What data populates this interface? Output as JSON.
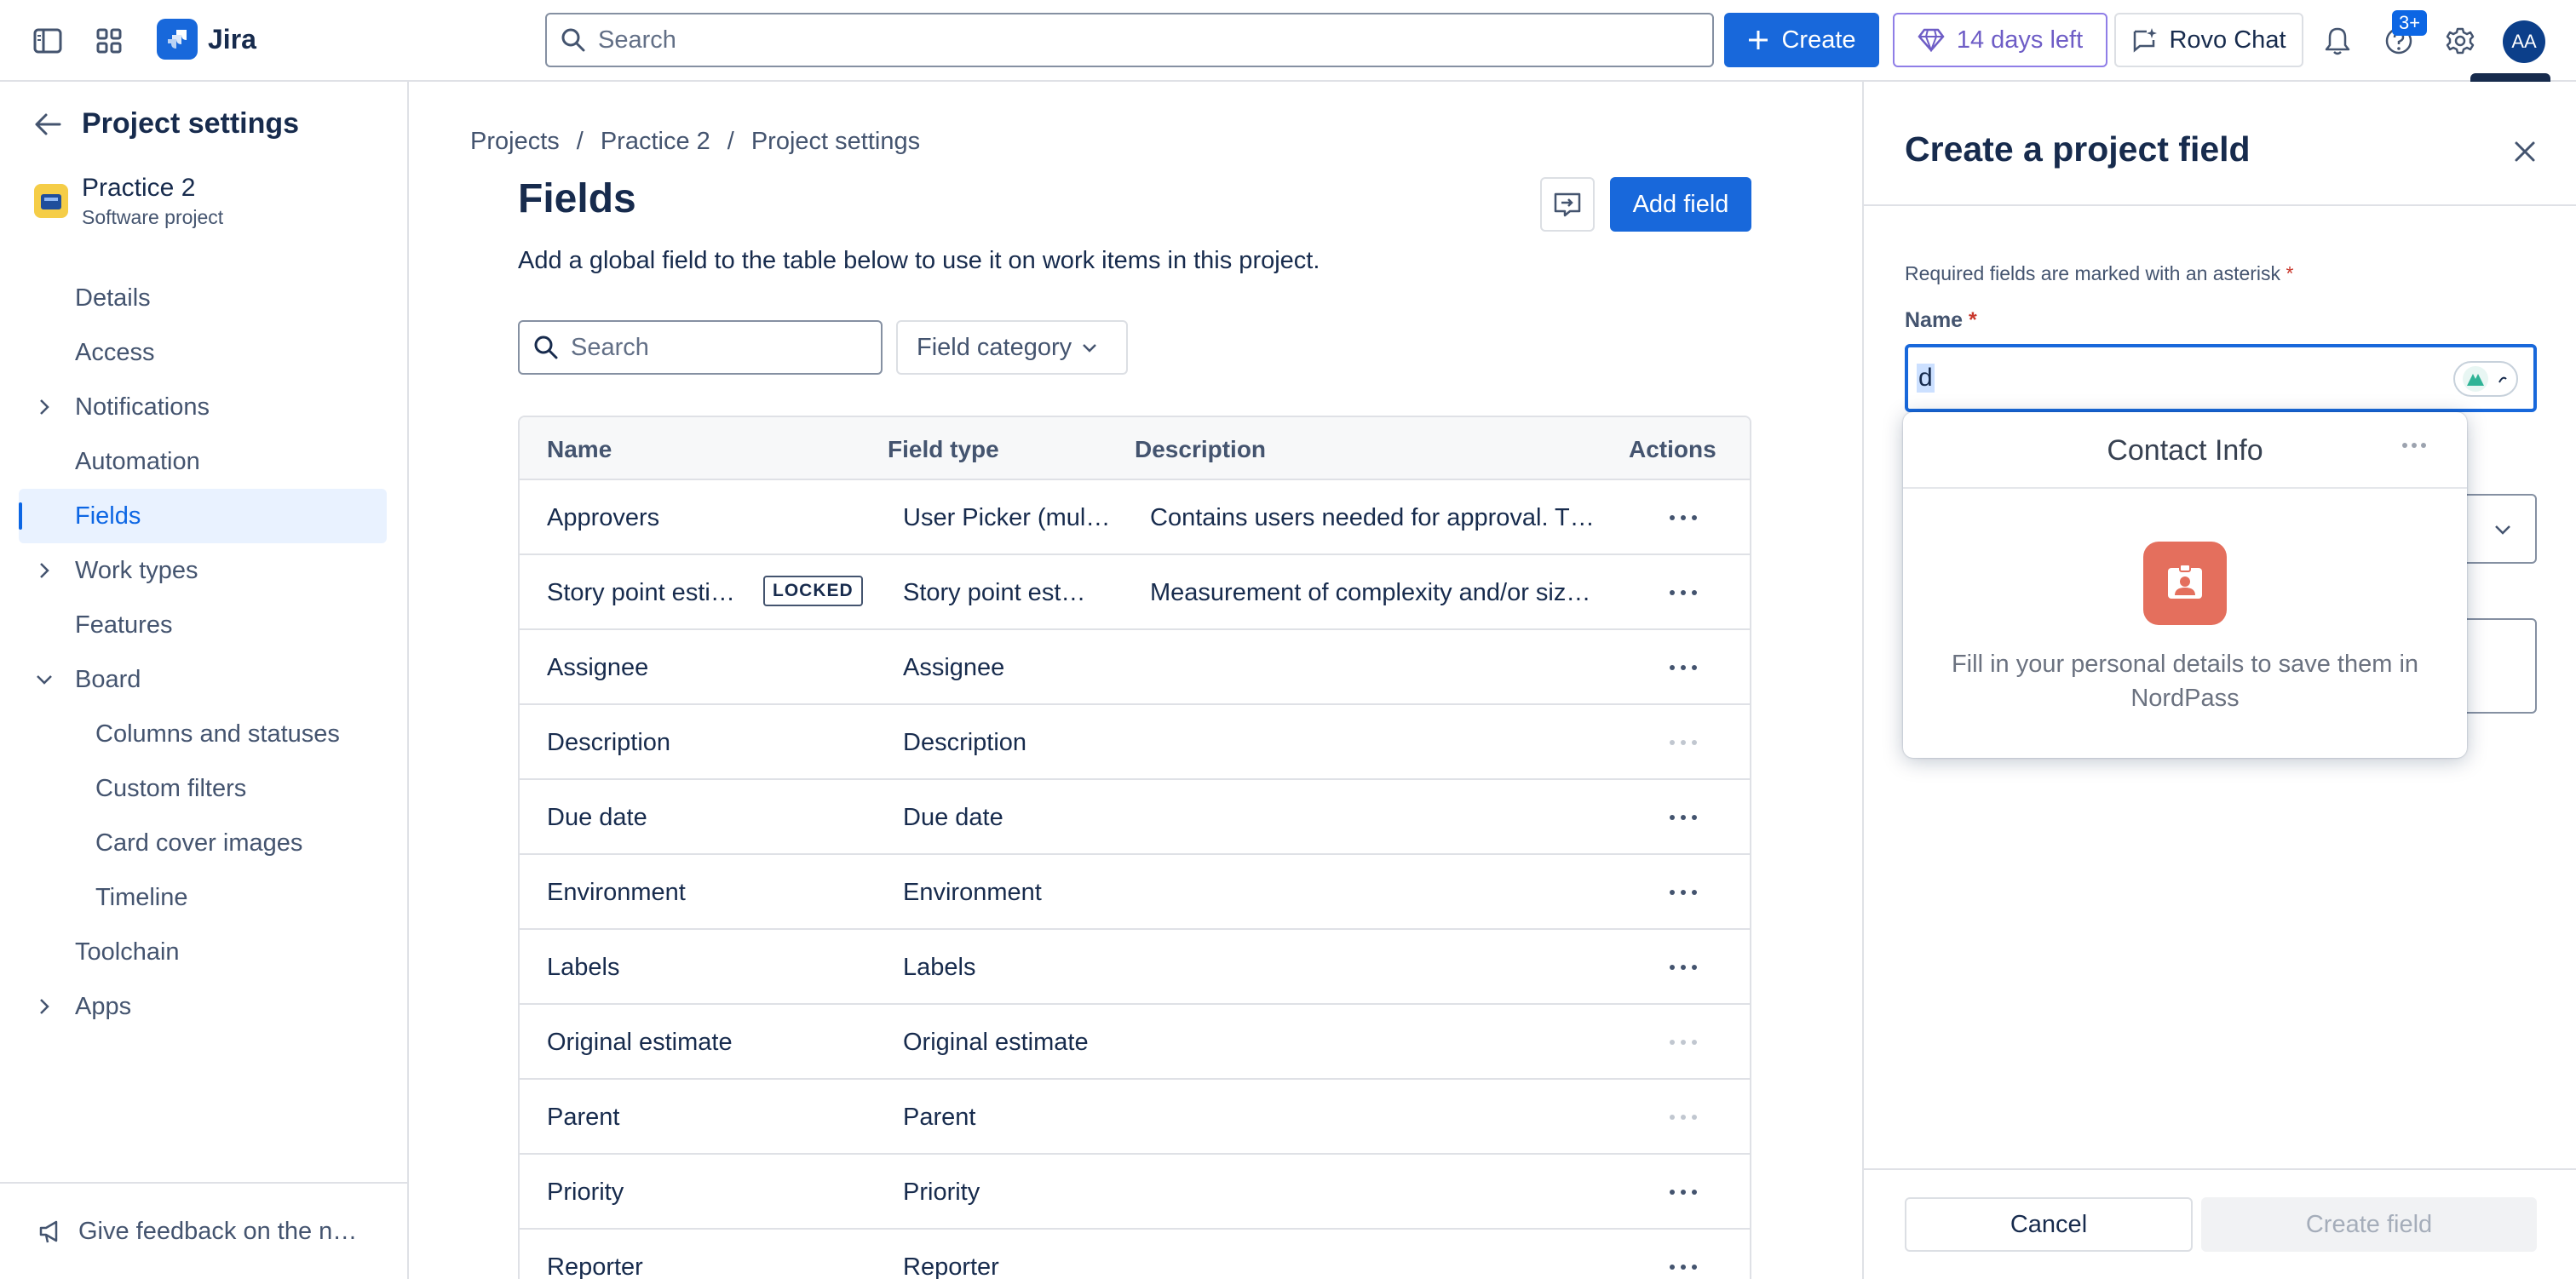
{
  "app": {
    "name": "Jira"
  },
  "topbar": {
    "search_placeholder": "Search",
    "create_label": "Create",
    "trial_label": "14 days left",
    "rovo_label": "Rovo Chat",
    "notifications_badge": "3+",
    "avatar_initials": "AA",
    "tooltip": "Close"
  },
  "sidebar": {
    "back_title": "Project settings",
    "project_name": "Practice 2",
    "project_type": "Software project",
    "items": [
      {
        "label": "Details"
      },
      {
        "label": "Access"
      },
      {
        "label": "Notifications"
      },
      {
        "label": "Automation"
      },
      {
        "label": "Fields"
      },
      {
        "label": "Work types"
      },
      {
        "label": "Features"
      },
      {
        "label": "Board"
      },
      {
        "label": "Columns and statuses"
      },
      {
        "label": "Custom filters"
      },
      {
        "label": "Card cover images"
      },
      {
        "label": "Timeline"
      },
      {
        "label": "Toolchain"
      },
      {
        "label": "Apps"
      }
    ],
    "feedback": "Give feedback on the new project settings"
  },
  "main": {
    "breadcrumb": [
      "Projects",
      "Practice 2",
      "Project settings"
    ],
    "title": "Fields",
    "add_field_label": "Add field",
    "description": "Add a global field to the table below to use it on work items in this project.",
    "search_placeholder": "Search",
    "field_category_label": "Field category",
    "table": {
      "headers": {
        "name": "Name",
        "type": "Field type",
        "description": "Description",
        "actions": "Actions"
      },
      "locked_label": "LOCKED",
      "rows": [
        {
          "name": "Approvers",
          "type": "User Picker (multiple users)",
          "description": "Contains users needed for approval. This custom field was created by Jira Service Management."
        },
        {
          "name": "Story point estimate",
          "type": "Story point estimate",
          "description": "Measurement of complexity and/or size of a requirement."
        },
        {
          "name": "Assignee",
          "type": "Assignee",
          "description": ""
        },
        {
          "name": "Description",
          "type": "Description",
          "description": ""
        },
        {
          "name": "Due date",
          "type": "Due date",
          "description": ""
        },
        {
          "name": "Environment",
          "type": "Environment",
          "description": ""
        },
        {
          "name": "Labels",
          "type": "Labels",
          "description": ""
        },
        {
          "name": "Original estimate",
          "type": "Original estimate",
          "description": ""
        },
        {
          "name": "Parent",
          "type": "Parent",
          "description": ""
        },
        {
          "name": "Priority",
          "type": "Priority",
          "description": ""
        },
        {
          "name": "Reporter",
          "type": "Reporter",
          "description": ""
        }
      ]
    }
  },
  "panel": {
    "title": "Create a project field",
    "required_note": "Required fields are marked with an asterisk",
    "asterisk": "*",
    "name_label": "Name",
    "name_value": "d",
    "cancel_label": "Cancel",
    "create_label": "Create field"
  },
  "nordpass": {
    "title": "Contact Info",
    "message": "Fill in your personal details to save them in NordPass"
  },
  "colors": {
    "brand_blue": "#1868db",
    "trial_purple": "#6e5dc6",
    "nordpass_icon": "#e46f5d"
  }
}
